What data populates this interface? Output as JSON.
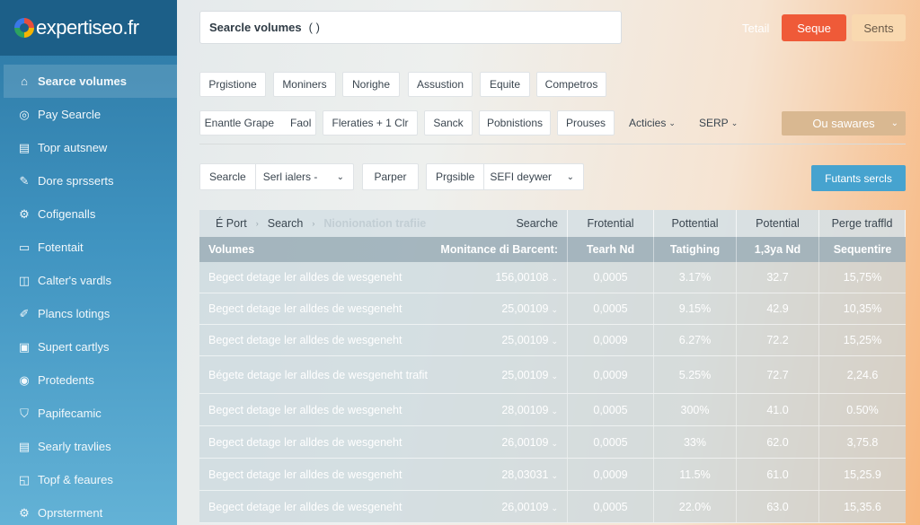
{
  "brand": {
    "name": "expertiseo.fr"
  },
  "sidebar": {
    "items": [
      {
        "label": "Searce volumes",
        "icon": "home-icon",
        "glyph": "⌂",
        "active": true
      },
      {
        "label": "Pay Searcle",
        "icon": "target-icon",
        "glyph": "◎"
      },
      {
        "label": "Topr autsnew",
        "icon": "document-icon",
        "glyph": "▤"
      },
      {
        "label": "Dore sprsserts",
        "icon": "pencil-icon",
        "glyph": "✎"
      },
      {
        "label": "Cofigenalls",
        "icon": "gear-icon",
        "glyph": "⚙"
      },
      {
        "label": "Fotentait",
        "icon": "file-icon",
        "glyph": "▭"
      },
      {
        "label": "Calter's vardls",
        "icon": "bag-icon",
        "glyph": "◫"
      },
      {
        "label": "Plancs lotings",
        "icon": "edit-icon",
        "glyph": "✐"
      },
      {
        "label": "Supert cartlys",
        "icon": "chart-icon",
        "glyph": "▣"
      },
      {
        "label": "Protedents",
        "icon": "user-icon",
        "glyph": "◉"
      },
      {
        "label": "Papifecamic",
        "icon": "shield-icon",
        "glyph": "⛉"
      },
      {
        "label": "Searly travlies",
        "icon": "document-icon",
        "glyph": "▤"
      },
      {
        "label": "Topf & feaures",
        "icon": "chat-icon",
        "glyph": "◱"
      },
      {
        "label": "Oprsterment",
        "icon": "settings-icon",
        "glyph": "⚙"
      }
    ]
  },
  "topbar": {
    "search_value": "Searcle volumes",
    "search_marker": "( )",
    "link_label": "Tetail",
    "primary_label": "Seque",
    "secondary_label": "Sents"
  },
  "chips_row1": [
    "Prgistione",
    "Moniners",
    "Norighe",
    "Assustion",
    "Equite",
    "Competros"
  ],
  "chips_row2": {
    "group": [
      "Enantle Grape",
      "Faol"
    ],
    "chips": [
      "Fleraties + 1 Clr",
      "Sanck",
      "Pobnistions",
      "Prouses"
    ],
    "plain": [
      "Acticies",
      "SERP"
    ],
    "dropdown_label": "Ou sawares"
  },
  "filters": {
    "group1": [
      "Searcle",
      "Serl ialers -"
    ],
    "single": "Parper",
    "group2": [
      "Prgsible",
      "SEFI deywer"
    ],
    "action_label": "Futants sercls"
  },
  "table": {
    "header1": {
      "a": "É Port",
      "b": "Search",
      "c": "Nionionation trafiie",
      "d": "Searche",
      "col2": "Frotential",
      "col3": "Pottential",
      "col4": "Potential",
      "col5": "Perge traffld"
    },
    "header2": {
      "left": "Volumes",
      "right": "Monitance di Barcent:",
      "col2": "Tearh Nd",
      "col3": "Tatighing",
      "col4": "1,3ya Nd",
      "col5": "Sequentire"
    },
    "rows": [
      {
        "name": "Begect detage ler alldes de wesgeneht",
        "volume": "156,00108",
        "c2": "0,0005",
        "c3": "3.17%",
        "c4": "32.7",
        "c5": "15,75%"
      },
      {
        "name": "Begect detage ler alldes de wesgeneht",
        "volume": "25,00109",
        "c2": "0,0005",
        "c3": "9.15%",
        "c4": "42.9",
        "c5": "10,35%"
      },
      {
        "name": "Begect detage ler alldes de wesgeneht",
        "volume": "25,00109",
        "c2": "0,0009",
        "c3": "6.27%",
        "c4": "72.2",
        "c5": "15,25%"
      },
      {
        "name": "Bégete detage ler alldes de wesgeneht trafit",
        "volume": "25,00109",
        "c2": "0,0009",
        "c3": "5.25%",
        "c4": "72.7",
        "c5": "2,24.6"
      },
      {
        "name": "Begect detage ler alldes de wesgeneht",
        "volume": "28,00109",
        "c2": "0,0005",
        "c3": "300%",
        "c4": "41.0",
        "c5": "0.50%"
      },
      {
        "name": "Begect detage ler alldes de wesgeneht",
        "volume": "26,00109",
        "c2": "0,0005",
        "c3": "33%",
        "c4": "62.0",
        "c5": "3,75.8"
      },
      {
        "name": "Begect detage ler alldes de wesgeneht",
        "volume": "28,03031",
        "c2": "0,0009",
        "c3": "11.5%",
        "c4": "61.0",
        "c5": "15,25.9"
      },
      {
        "name": "Begect detage ler alldes de wesgeneht",
        "volume": "26,00109",
        "c2": "0,0005",
        "c3": "22.0%",
        "c4": "63.0",
        "c5": "15,35.6"
      }
    ]
  },
  "colors": {
    "primary": "#ef5a38",
    "accent": "#46a3cf",
    "sidebar": "#2c78a4"
  }
}
